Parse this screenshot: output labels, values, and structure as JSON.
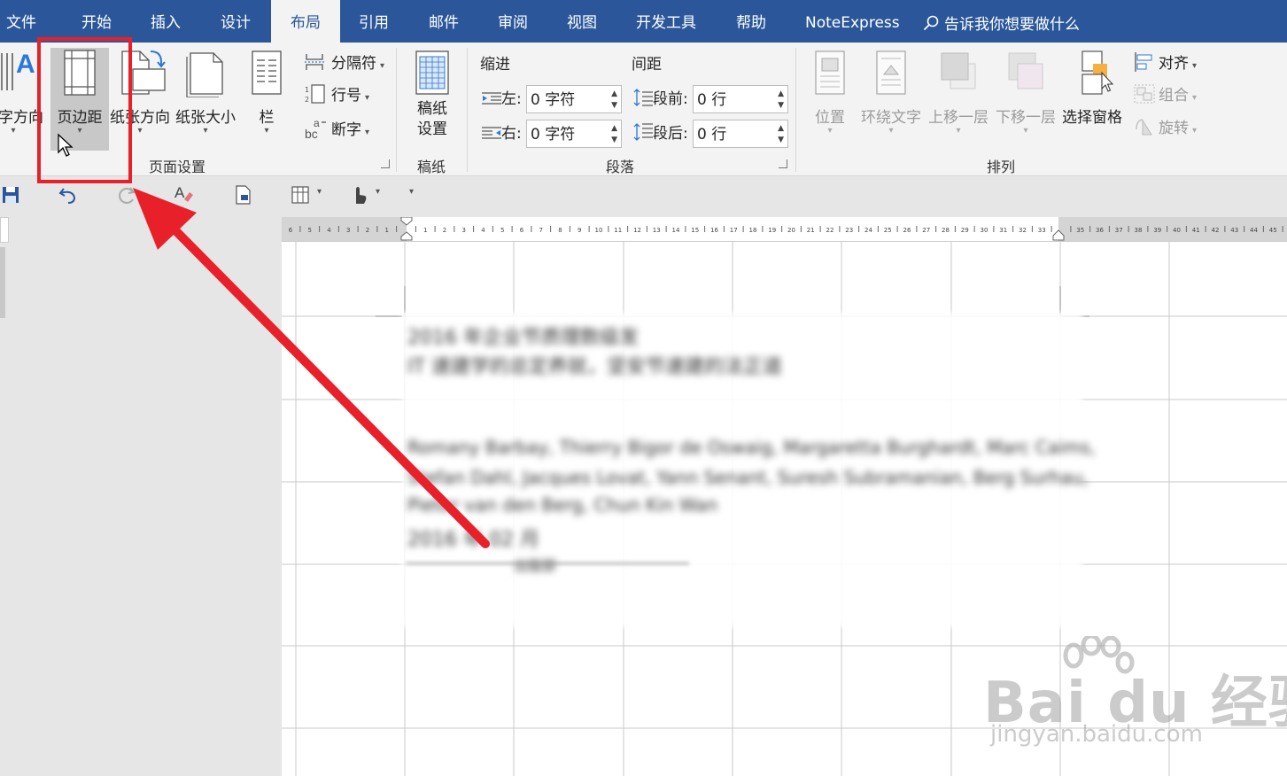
{
  "tabs": [
    {
      "label": "文件",
      "active": false
    },
    {
      "label": "开始",
      "active": false
    },
    {
      "label": "插入",
      "active": false
    },
    {
      "label": "设计",
      "active": false
    },
    {
      "label": "布局",
      "active": true
    },
    {
      "label": "引用",
      "active": false
    },
    {
      "label": "邮件",
      "active": false
    },
    {
      "label": "审阅",
      "active": false
    },
    {
      "label": "视图",
      "active": false
    },
    {
      "label": "开发工具",
      "active": false
    },
    {
      "label": "帮助",
      "active": false
    },
    {
      "label": "NoteExpress",
      "active": false
    }
  ],
  "tell_me": "告诉我你想要做什么",
  "page_setup": {
    "text_direction": "文字方向",
    "margins": "页边距",
    "orientation": "纸张方向",
    "size": "纸张大小",
    "columns": "栏",
    "breaks": "分隔符",
    "line_numbers": "行号",
    "hyphenation": "断字",
    "group_label": "页面设置"
  },
  "manuscript": {
    "settings": "稿纸\n设置",
    "group_label": "稿纸"
  },
  "paragraph": {
    "indent_title": "缩进",
    "spacing_title": "间距",
    "left_label": "左:",
    "left_value": "0 字符",
    "right_label": "右:",
    "right_value": "0 字符",
    "before_label": "段前:",
    "before_value": "0 行",
    "after_label": "段后:",
    "after_value": "0 行",
    "group_label": "段落"
  },
  "arrange": {
    "position": "位置",
    "wrap_text": "环绕文字",
    "bring_forward": "上移一层",
    "send_backward": "下移一层",
    "selection_pane": "选择窗格",
    "align": "对齐",
    "group": "组合",
    "rotate": "旋转",
    "group_label": "排列"
  },
  "ruler_ticks": [
    "6",
    "5",
    "4",
    "3",
    "2",
    "1",
    "",
    "1",
    "2",
    "3",
    "4",
    "5",
    "6",
    "7",
    "8",
    "9",
    "10",
    "11",
    "12",
    "13",
    "14",
    "15",
    "16",
    "17",
    "18",
    "19",
    "20",
    "21",
    "22",
    "23",
    "24",
    "25",
    "26",
    "27",
    "28",
    "29",
    "30",
    "31",
    "32",
    "33",
    "",
    "35",
    "36",
    "37",
    "38",
    "39",
    "40",
    "41",
    "42",
    "43",
    "44",
    "45"
  ],
  "doc_lines": [
    "2016 年企业节质理数级发",
    "IT 速建学的总定养就，坚安节速建的法正道",
    "Romany Barbay, Thierry Bigor de Oswaig, Margaretta Burghardt, Marc Caims,",
    "Stefan Dahl, Jacques Lovat, Yann Senant, Suresh Subramanian, Berg Surhau,",
    "Pieter van den Berg, Chun Kin Wan",
    "2016 年 02 月",
    "出版部"
  ],
  "watermark": {
    "main": "Bai du 经验",
    "sub": "jingyan.baidu.com"
  },
  "colors": {
    "tab_bar": "#2b579a",
    "ribbon": "#f3f3f3",
    "highlight_red": "#e8202a"
  }
}
